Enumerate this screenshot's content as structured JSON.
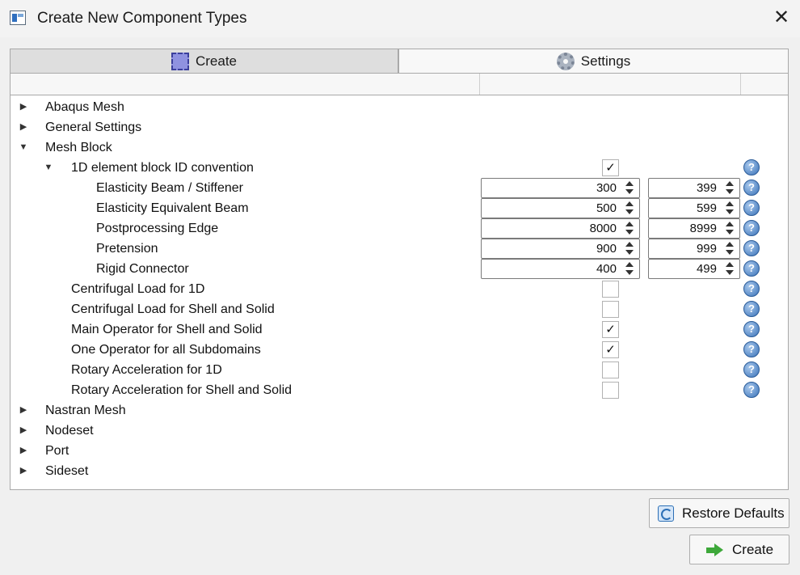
{
  "window": {
    "title": "Create New Component Types",
    "close_glyph": "✕"
  },
  "tabs": [
    {
      "label": "Create",
      "icon": "create-icon",
      "selected": true
    },
    {
      "label": "Settings",
      "icon": "gear-icon",
      "selected": false
    }
  ],
  "tree": {
    "abaqus": "Abaqus Mesh",
    "general": "General Settings",
    "mesh_block": "Mesh Block",
    "convention": {
      "label": "1D element block ID convention",
      "checked": "✓",
      "items": [
        {
          "label": "Elasticity Beam / Stiffener",
          "min": "300",
          "max": "399"
        },
        {
          "label": "Elasticity Equivalent Beam",
          "min": "500",
          "max": "599"
        },
        {
          "label": "Postprocessing Edge",
          "min": "8000",
          "max": "8999"
        },
        {
          "label": "Pretension",
          "min": "900",
          "max": "999"
        },
        {
          "label": "Rigid Connector",
          "min": "400",
          "max": "499"
        }
      ]
    },
    "options": [
      {
        "label": "Centrifugal Load for 1D",
        "checked": ""
      },
      {
        "label": "Centrifugal Load for Shell and Solid",
        "checked": ""
      },
      {
        "label": "Main Operator for Shell and Solid",
        "checked": "✓"
      },
      {
        "label": "One Operator for all Subdomains",
        "checked": "✓"
      },
      {
        "label": "Rotary Acceleration for 1D",
        "checked": ""
      },
      {
        "label": "Rotary Acceleration for Shell and Solid",
        "checked": ""
      }
    ],
    "nastran": "Nastran Mesh",
    "nodeset": "Nodeset",
    "port": "Port",
    "sideset": "Sideset"
  },
  "help_glyph": "?",
  "buttons": {
    "restore": "Restore Defaults",
    "create": "Create"
  }
}
